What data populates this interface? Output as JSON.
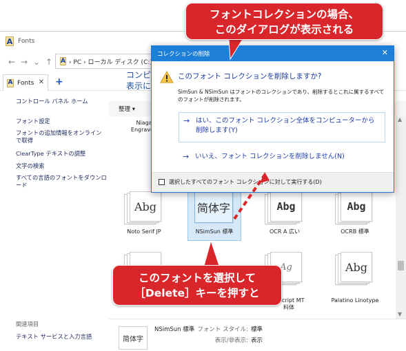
{
  "window": {
    "title": "Fonts",
    "nav": {
      "back": "←",
      "forward": "→",
      "recent": "⌄",
      "up": "↑"
    },
    "address_path": "›  PC  ›  ローカル ディスク (C:)",
    "tab_label": "Fonts",
    "tab_close": "✕",
    "tab_add": "+"
  },
  "sidebar": {
    "home": "コントロール パネル ホーム",
    "links": [
      "フォント設定",
      "フォントの追加情報をオンラインで取得",
      "ClearType テキストの調整",
      "文字の検索",
      "すべての言語のフォントをダウンロード"
    ],
    "related_heading": "関連項目",
    "related_link": "テキスト サービスと入力言語"
  },
  "main": {
    "heading_line1": "コンピ",
    "heading_line2": "表示に",
    "toolbar_organize": "整理 ▾",
    "tiles": [
      {
        "name_line1": "Niaga",
        "name_line2": "Engraved"
      },
      {
        "name_line1": "Noto Serif JP",
        "sample": "Abg"
      },
      {
        "name_line1": "NSimSun 標準",
        "sample": "简体字"
      },
      {
        "name_line1": "OCR A 広い",
        "sample": "Abg"
      },
      {
        "name_line1": "OCRB 標準",
        "sample": "Abg"
      },
      {
        "name_line1": "e Script MT",
        "name_line2": "料体",
        "sample": "Ag"
      },
      {
        "name_line1": "Palatino Linotype",
        "sample": "Abg"
      }
    ],
    "scroll_up": "▲",
    "scroll_down": "▼"
  },
  "details": {
    "thumb_sample": "简体字",
    "name": "NSimSun 標準",
    "style_label": "フォント スタイル:",
    "style_value": "標準",
    "visibility_label": "表示/非表示:",
    "visibility_value": "表示"
  },
  "dialog": {
    "title": "コレクションの削除",
    "close": "✕",
    "question": "このフォント コレクションを削除しますか?",
    "description": "SimSun & NSimSun はフォントのコレクションであり、削除するとこれに属するすべてのフォントが削除されます。",
    "option_yes_arrow": "→",
    "option_yes": "はい、このフォント コレクション全体をコンピューターから削除します(Y)",
    "option_no_arrow": "→",
    "option_no": "いいえ、フォント コレクションを削除しません(N)",
    "apply_all_label": "選択したすべてのフォント コレクションに対して実行する(D)"
  },
  "callouts": {
    "top_line1": "フォントコレクションの場合、",
    "top_line2": "このダイアログが表示される",
    "bottom_line1": "このフォントを選択して",
    "bottom_line2": "［Delete］キーを押すと"
  },
  "colors": {
    "callout_red": "#d9262b",
    "dialog_titlebar": "#1e7fd8",
    "link_blue": "#1a3aa8",
    "selection_blue": "#d7e9f8"
  },
  "icons": [
    "fonts-app-icon",
    "warning-icon",
    "arrow-right-icon",
    "close-icon",
    "plus-icon"
  ]
}
